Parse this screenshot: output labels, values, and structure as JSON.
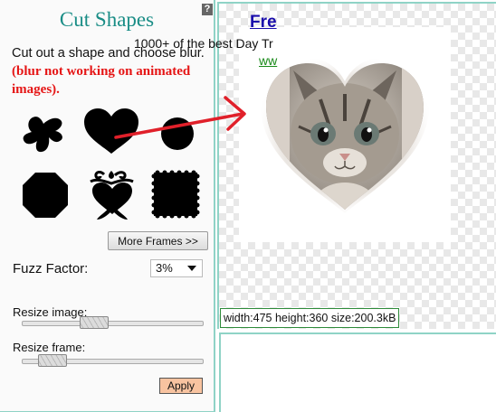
{
  "panel": {
    "title": "Cut Shapes",
    "help": "?",
    "instructions": "Cut out a shape and choose blur.",
    "warning": "(blur not working on animated images).",
    "shapes": [
      "splat-shape",
      "heart-shape",
      "circle-shape",
      "octagon-shape",
      "ornate-heart-shape",
      "stamp-shape"
    ],
    "more_frames_label": "More Frames >>",
    "fuzz_label": "Fuzz Factor:",
    "fuzz_value": "3%",
    "resize_image_label": "Resize image:",
    "resize_image_value": 0.38,
    "resize_frame_label": "Resize frame:",
    "resize_frame_value": 0.1,
    "apply_label": "Apply"
  },
  "preview": {
    "size_info": "width:475 height:360 size:200.3kB"
  },
  "ad": {
    "title": "Fre",
    "text": "1000+ of the best Day Tr",
    "link": "ww"
  },
  "colors": {
    "accent": "#1a8d86",
    "warning": "#e51515",
    "apply_bg": "#f8c3a0",
    "arrow": "#e0202a"
  }
}
